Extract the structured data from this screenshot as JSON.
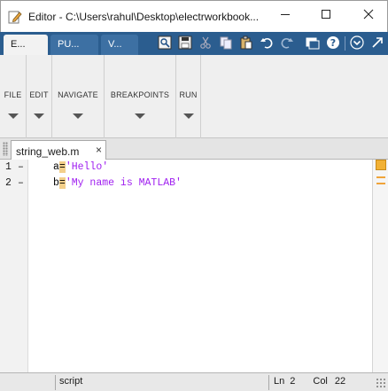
{
  "window": {
    "title": "Editor - C:\\Users\\rahul\\Desktop\\electrworkbook...",
    "app_icon": "editor-pencil-icon",
    "controls": [
      "minimize-icon",
      "maximize-icon",
      "close-icon"
    ]
  },
  "toolstrip_tabs": [
    {
      "label": "E...",
      "active": true
    },
    {
      "label": "PU...",
      "active": false
    },
    {
      "label": "V...",
      "active": false
    }
  ],
  "quick_access": [
    "find-files-icon",
    "save-icon",
    "cut-icon",
    "copy-icon",
    "paste-icon",
    "undo-icon",
    "redo-icon",
    "switch-windows-icon",
    "help-icon",
    "expand-toolstrip-icon"
  ],
  "ribbon": {
    "sections": [
      {
        "label": "FILE"
      },
      {
        "label": "EDIT"
      },
      {
        "label": "NAVIGATE"
      },
      {
        "label": "BREAKPOINTS"
      },
      {
        "label": "RUN"
      }
    ]
  },
  "document_tab": {
    "label": "string_web.m",
    "close": "×"
  },
  "editor": {
    "lines": [
      {
        "number": "1",
        "dash": "–",
        "var": "a",
        "op": "=",
        "value": "'Hello'"
      },
      {
        "number": "2",
        "dash": "–",
        "var": "b",
        "op": "=",
        "value": "'My name is MATLAB'"
      }
    ],
    "colors": {
      "string": "#a020f0",
      "warning": "#f2b134"
    }
  },
  "statusbar": {
    "type": "script",
    "ln_label": "Ln",
    "ln_value": "2",
    "col_label": "Col",
    "col_value": "22"
  }
}
